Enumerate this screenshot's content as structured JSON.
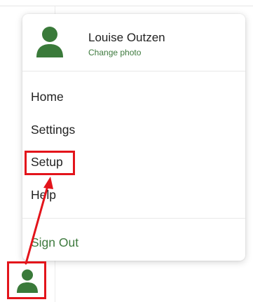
{
  "profile": {
    "name": "Louise Outzen",
    "change_photo": "Change photo",
    "avatar_icon": "user-icon"
  },
  "menu": {
    "items": [
      {
        "label": "Home"
      },
      {
        "label": "Settings"
      },
      {
        "label": "Setup"
      },
      {
        "label": "Help"
      }
    ],
    "sign_out": "Sign Out"
  },
  "annotation": {
    "highlight_color": "#e3141b",
    "highlighted_item": "Setup",
    "arrow_from": "user-button",
    "arrow_to": "Setup"
  },
  "colors": {
    "accent_green": "#3e7a3e",
    "avatar_green": "#3a7a3a"
  }
}
